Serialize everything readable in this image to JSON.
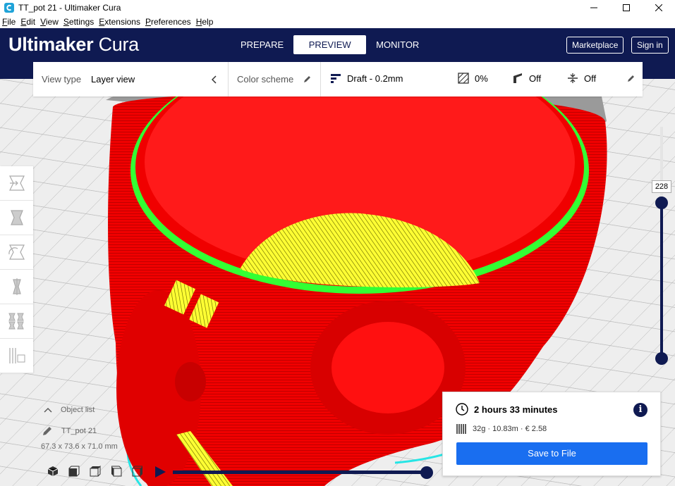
{
  "window": {
    "title": "TT_pot 21 - Ultimaker Cura",
    "minimize_icon": "minimize-icon",
    "maximize_icon": "maximize-icon",
    "close_icon": "close-icon"
  },
  "menu": {
    "items": [
      {
        "key": "F",
        "rest": "ile"
      },
      {
        "key": "E",
        "rest": "dit"
      },
      {
        "key": "V",
        "rest": "iew"
      },
      {
        "key": "S",
        "rest": "ettings"
      },
      {
        "key": "E",
        "rest": "xtensions"
      },
      {
        "key": "P",
        "rest": "references"
      },
      {
        "key": "H",
        "rest": "elp"
      }
    ]
  },
  "header": {
    "logo_bold": "Ultimaker",
    "logo_light": "Cura",
    "tabs": [
      {
        "label": "PREPARE",
        "active": false
      },
      {
        "label": "PREVIEW",
        "active": true
      },
      {
        "label": "MONITOR",
        "active": false
      }
    ],
    "marketplace_label": "Marketplace",
    "signin_label": "Sign in",
    "brand_color": "#0f1a52"
  },
  "toolbar": {
    "view_type_label": "View type",
    "view_type_value": "Layer view",
    "color_scheme_label": "Color scheme",
    "profile_label": "Draft - 0.2mm",
    "infill_value": "0%",
    "support_value": "Off",
    "adhesion_value": "Off"
  },
  "left_tools": [
    "move-tool",
    "scale-tool",
    "rotate-tool",
    "mirror-tool",
    "per-model-settings-tool",
    "support-blocker-tool"
  ],
  "object_list": {
    "header": "Object list",
    "object_name": "TT_pot 21",
    "dimensions": "67.3 x 73.6 x 71.0 mm"
  },
  "layer_slider": {
    "current_layer": "228"
  },
  "print_info": {
    "time": "2 hours 33 minutes",
    "material": "32g · 10.83m · € 2.58",
    "save_label": "Save to File",
    "save_color": "#196ef0"
  },
  "colors": {
    "model_red": "#ff0000",
    "infill_yellow": "#ffff33",
    "walls_green": "#33ff33",
    "travel_cyan": "#26e5e5"
  }
}
